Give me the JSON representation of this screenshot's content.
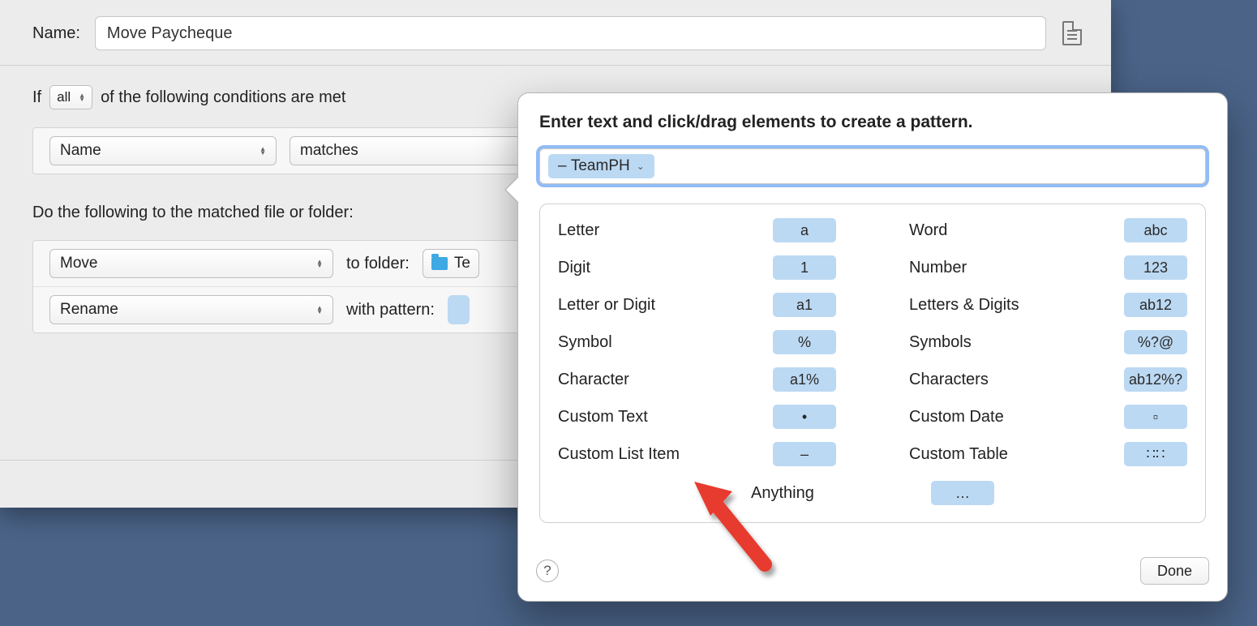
{
  "header": {
    "label": "Name:",
    "value": "Move Paycheque"
  },
  "conditions": {
    "prefix": "If",
    "mode": "all",
    "suffix": "of the following conditions are met",
    "rows": [
      {
        "field": "Name",
        "op": "matches"
      }
    ]
  },
  "actions": {
    "heading": "Do the following to the matched file or folder:",
    "rows": [
      {
        "act": "Move",
        "mid": "to folder:",
        "target": "Te"
      },
      {
        "act": "Rename",
        "mid": "with pattern:",
        "target": ""
      }
    ]
  },
  "popover": {
    "title": "Enter text and click/drag elements to create a pattern.",
    "token": {
      "prefix": "–",
      "label": "TeamPH"
    },
    "palette": {
      "left": [
        {
          "label": "Letter",
          "badge": "a"
        },
        {
          "label": "Digit",
          "badge": "1"
        },
        {
          "label": "Letter or Digit",
          "badge": "a1"
        },
        {
          "label": "Symbol",
          "badge": "%"
        },
        {
          "label": "Character",
          "badge": "a1%"
        },
        {
          "label": "Custom Text",
          "badge": "•"
        },
        {
          "label": "Custom List Item",
          "badge": "–"
        }
      ],
      "right": [
        {
          "label": "Word",
          "badge": "abc"
        },
        {
          "label": "Number",
          "badge": "123"
        },
        {
          "label": "Letters & Digits",
          "badge": "ab12"
        },
        {
          "label": "Symbols",
          "badge": "%?@"
        },
        {
          "label": "Characters",
          "badge": "ab12%?"
        },
        {
          "label": "Custom Date",
          "badge": "▫"
        },
        {
          "label": "Custom Table",
          "badge": "∷∷"
        }
      ],
      "anything": {
        "label": "Anything",
        "badge": "…"
      }
    },
    "help": "?",
    "done": "Done"
  }
}
